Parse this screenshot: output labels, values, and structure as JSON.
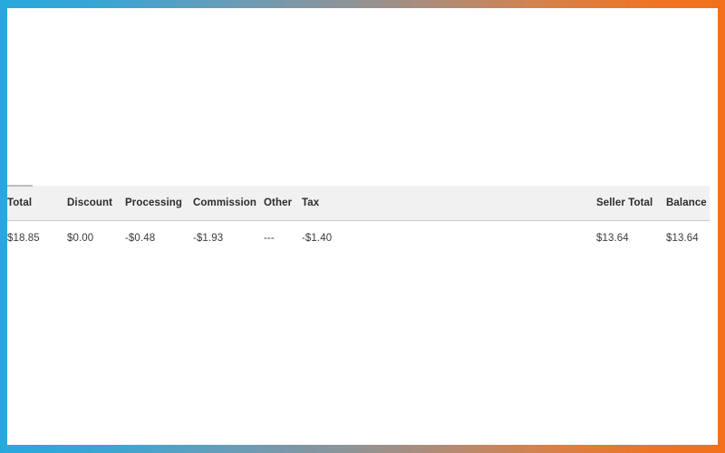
{
  "frame": {
    "gradient_start": "#27a8dd",
    "gradient_end": "#ee7424"
  },
  "table": {
    "name": "transaction-summary",
    "header_bg": "#f1f1f1",
    "row_bg": "#ffffff",
    "columns": [
      {
        "key": "total",
        "label": "Total"
      },
      {
        "key": "discount",
        "label": "Discount"
      },
      {
        "key": "processing",
        "label": "Processing"
      },
      {
        "key": "commission",
        "label": "Commission"
      },
      {
        "key": "other",
        "label": "Other"
      },
      {
        "key": "tax",
        "label": "Tax"
      },
      {
        "key": "seller_total",
        "label": "Seller Total"
      },
      {
        "key": "balance",
        "label": "Balance"
      }
    ],
    "rows": [
      {
        "total": "$18.85",
        "discount": "$0.00",
        "processing": "-$0.48",
        "commission": "-$1.93",
        "other": "---",
        "tax": "-$1.40",
        "seller_total": "$13.64",
        "balance": "$13.64"
      }
    ]
  }
}
